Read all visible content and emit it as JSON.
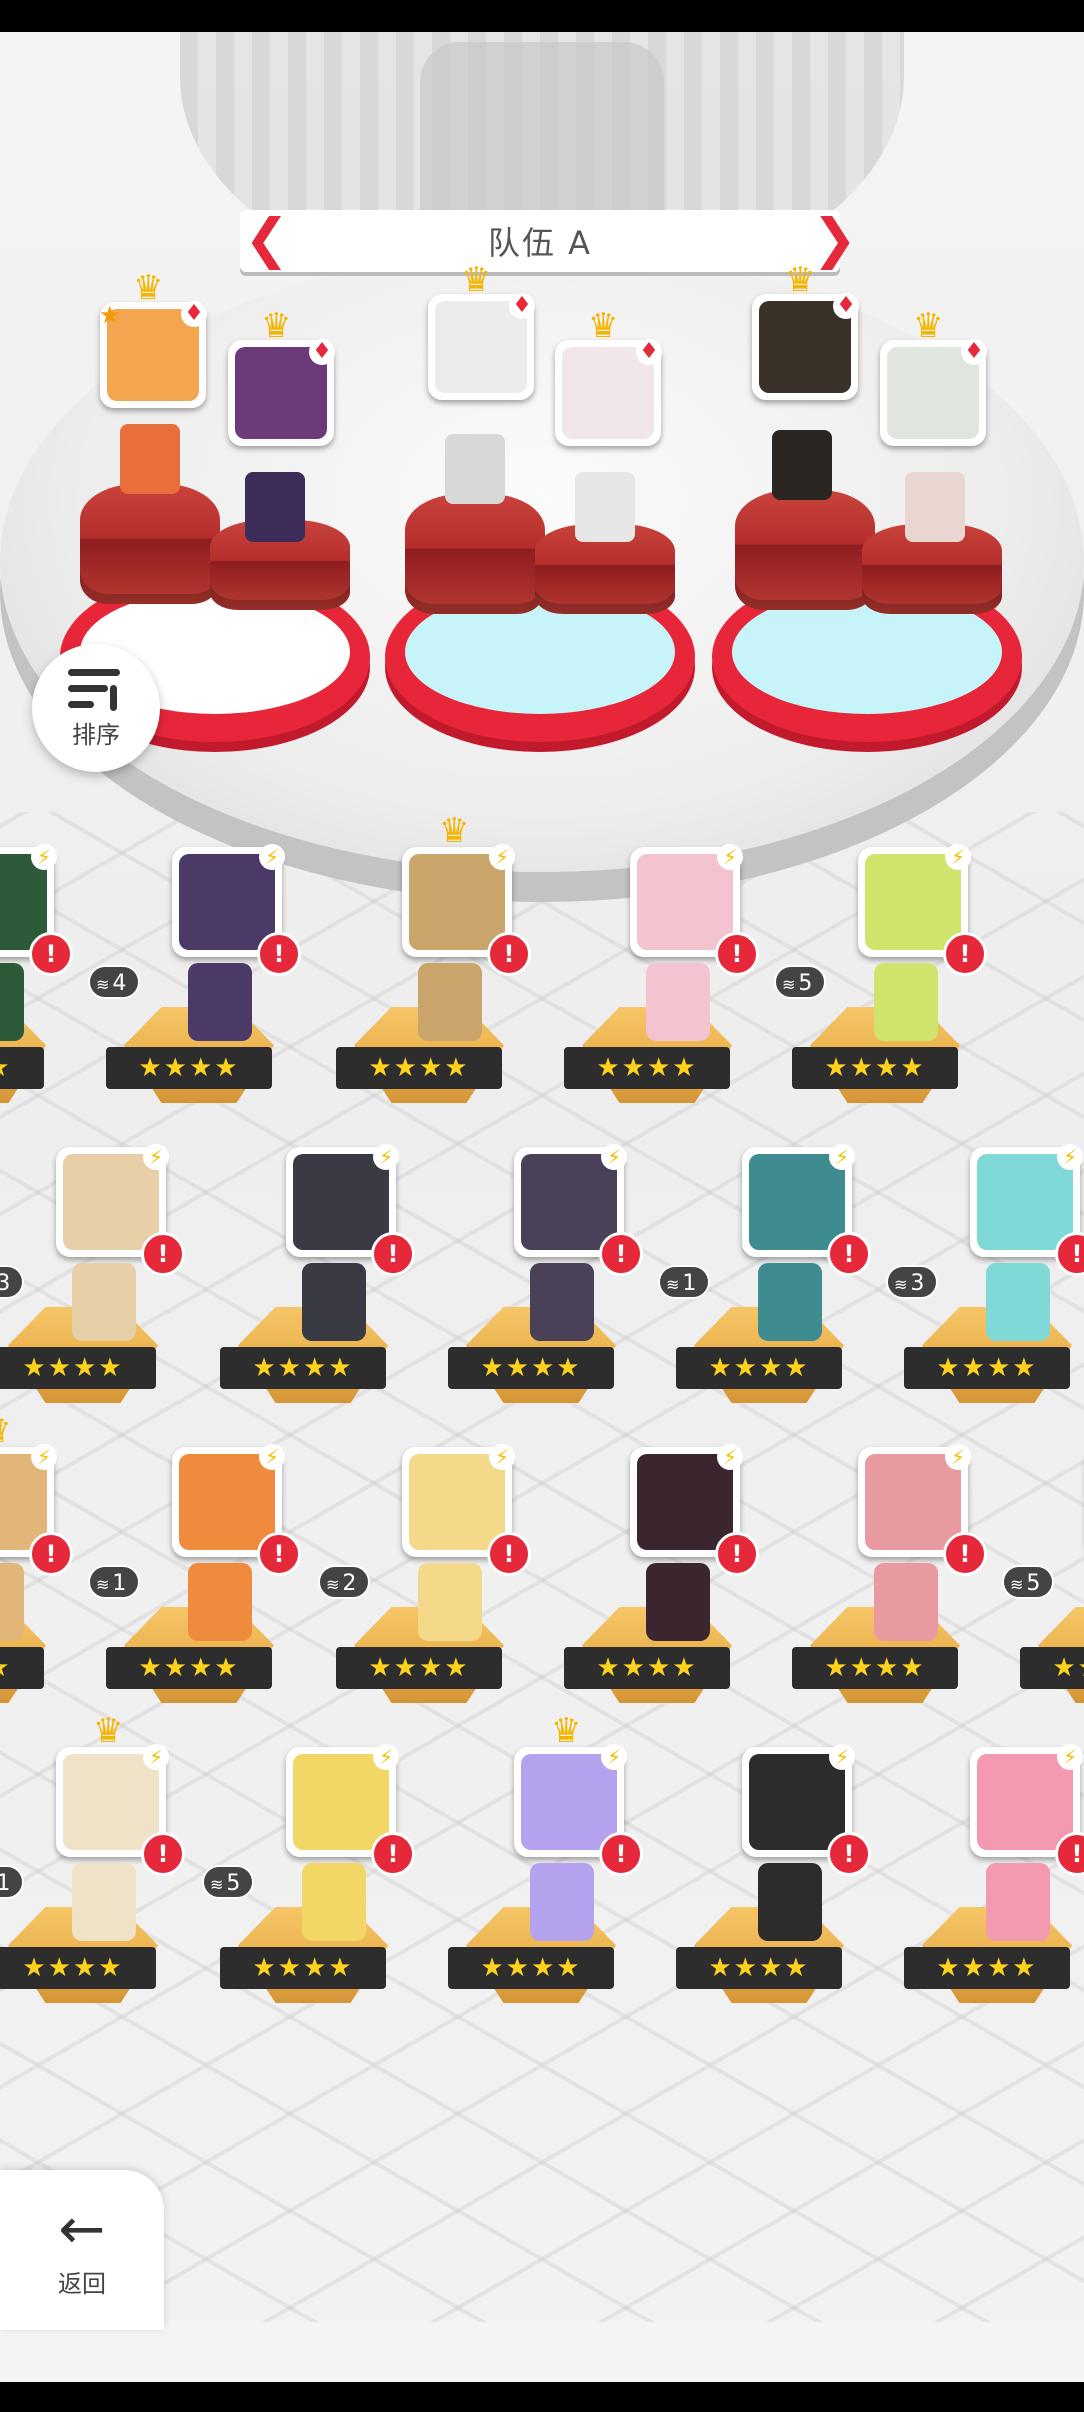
{
  "team": {
    "title": "队伍 A",
    "prev_arrow": "❮",
    "next_arrow": "❯"
  },
  "sort_button": {
    "label": "排序",
    "icon": "sort-icon"
  },
  "back_button": {
    "label": "返回",
    "icon": "back-arrow-icon"
  },
  "team_members": [
    {
      "badge": "★",
      "suit": "♦",
      "crown": "♛",
      "color": "#f4a64e"
    },
    {
      "badge": "",
      "suit": "♦",
      "crown": "♛",
      "color": "#6c3a7a"
    },
    {
      "badge": "",
      "suit": "♦",
      "crown": "♛",
      "color": "#ececec"
    },
    {
      "badge": "",
      "suit": "♦",
      "crown": "♛",
      "color": "#f1e7e9"
    },
    {
      "badge": "",
      "suit": "♦",
      "crown": "♛",
      "color": "#3a3128"
    },
    {
      "badge": "",
      "suit": "♦",
      "crown": "♛",
      "color": "#dfe6dd"
    }
  ],
  "roster": {
    "stars": "★★★★",
    "bolt": "⚡",
    "alert": "!",
    "stack_icon": "≋",
    "rows": [
      [
        {
          "level": "",
          "crown": false,
          "color": "#2d5b3a",
          "partial": "left"
        },
        {
          "level": "4",
          "crown": false,
          "color": "#4b3a68"
        },
        {
          "level": "",
          "crown": true,
          "color": "#c9a56b"
        },
        {
          "level": "",
          "crown": false,
          "color": "#f3c3cf"
        },
        {
          "level": "5",
          "crown": false,
          "color": "#cfe46a"
        }
      ],
      [
        {
          "level": "3",
          "crown": false,
          "color": "#e7cfa8"
        },
        {
          "level": "",
          "crown": false,
          "color": "#3a3a44"
        },
        {
          "level": "",
          "crown": false,
          "color": "#4a4057"
        },
        {
          "level": "1",
          "crown": false,
          "color": "#3e8c8f"
        },
        {
          "level": "3",
          "crown": false,
          "color": "#7fd9d6",
          "partial": "right"
        }
      ],
      [
        {
          "level": "",
          "crown": true,
          "color": "#e2b678",
          "partial": "left"
        },
        {
          "level": "1",
          "crown": false,
          "color": "#f08a3c"
        },
        {
          "level": "2",
          "crown": false,
          "color": "#f5d98a"
        },
        {
          "level": "",
          "crown": false,
          "color": "#3b2630"
        },
        {
          "level": "",
          "crown": false,
          "color": "#e99aa1"
        },
        {
          "level": "5",
          "crown": false,
          "color": "#999",
          "partial": "right-edge"
        }
      ],
      [
        {
          "level": "1",
          "crown": true,
          "color": "#f0e2c6"
        },
        {
          "level": "5",
          "crown": false,
          "color": "#f2d766"
        },
        {
          "level": "",
          "crown": true,
          "color": "#b5a2ef"
        },
        {
          "level": "",
          "crown": false,
          "color": "#2c2c2c"
        },
        {
          "level": "",
          "crown": false,
          "color": "#f49ab0",
          "partial": "right"
        }
      ]
    ]
  }
}
